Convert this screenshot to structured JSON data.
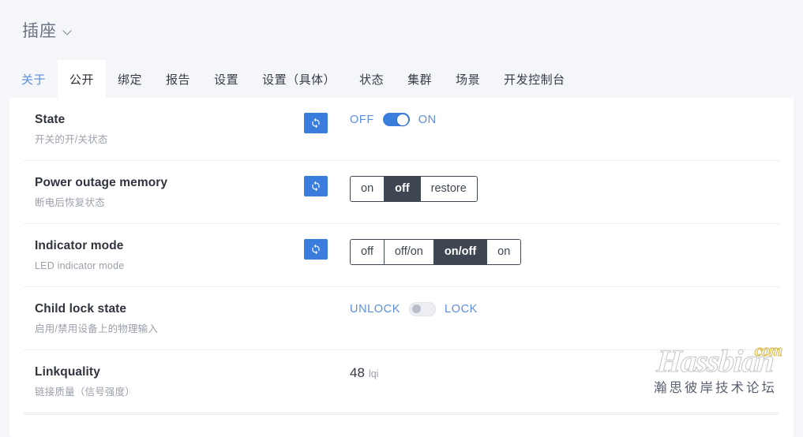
{
  "header": {
    "device_title": "插座",
    "chevron_icon": "chevron-down-icon"
  },
  "tabs": [
    {
      "label": "关于",
      "state": "link"
    },
    {
      "label": "公开",
      "state": "active"
    },
    {
      "label": "绑定",
      "state": "normal"
    },
    {
      "label": "报告",
      "state": "normal"
    },
    {
      "label": "设置",
      "state": "normal"
    },
    {
      "label": "设置（具体）",
      "state": "normal"
    },
    {
      "label": "状态",
      "state": "normal"
    },
    {
      "label": "集群",
      "state": "normal"
    },
    {
      "label": "场景",
      "state": "normal"
    },
    {
      "label": "开发控制台",
      "state": "normal"
    }
  ],
  "properties": [
    {
      "name": "State",
      "description": "开关的开/关状态",
      "has_refresh": true,
      "refresh_icon": "refresh-icon",
      "control": "toggle",
      "off_label": "OFF",
      "on_label": "ON",
      "value": "on"
    },
    {
      "name": "Power outage memory",
      "description": "断电后恢复状态",
      "has_refresh": true,
      "refresh_icon": "refresh-icon",
      "control": "segmented",
      "options": [
        "on",
        "off",
        "restore"
      ],
      "value": "off"
    },
    {
      "name": "Indicator mode",
      "description": "LED indicator mode",
      "has_refresh": true,
      "refresh_icon": "refresh-icon",
      "control": "segmented",
      "options": [
        "off",
        "off/on",
        "on/off",
        "on"
      ],
      "value": "on/off"
    },
    {
      "name": "Child lock state",
      "description": "启用/禁用设备上的物理输入",
      "has_refresh": false,
      "control": "toggle",
      "off_label": "UNLOCK",
      "on_label": "LOCK",
      "value": "off"
    },
    {
      "name": "Linkquality",
      "description": "链接质量（信号强度）",
      "has_refresh": false,
      "control": "value",
      "value": "48",
      "unit": "lqi"
    }
  ],
  "watermark": {
    "logo": "Hassbian",
    "tld": "com",
    "subtitle": "瀚思彼岸技术论坛"
  },
  "colors": {
    "accent_blue": "#3b7ddd",
    "link_blue": "#5b8fde",
    "segment_dark": "#3e4651",
    "page_bg": "#f5f6fa",
    "card_bg": "#ffffff",
    "muted_text": "#9aa0ab"
  }
}
